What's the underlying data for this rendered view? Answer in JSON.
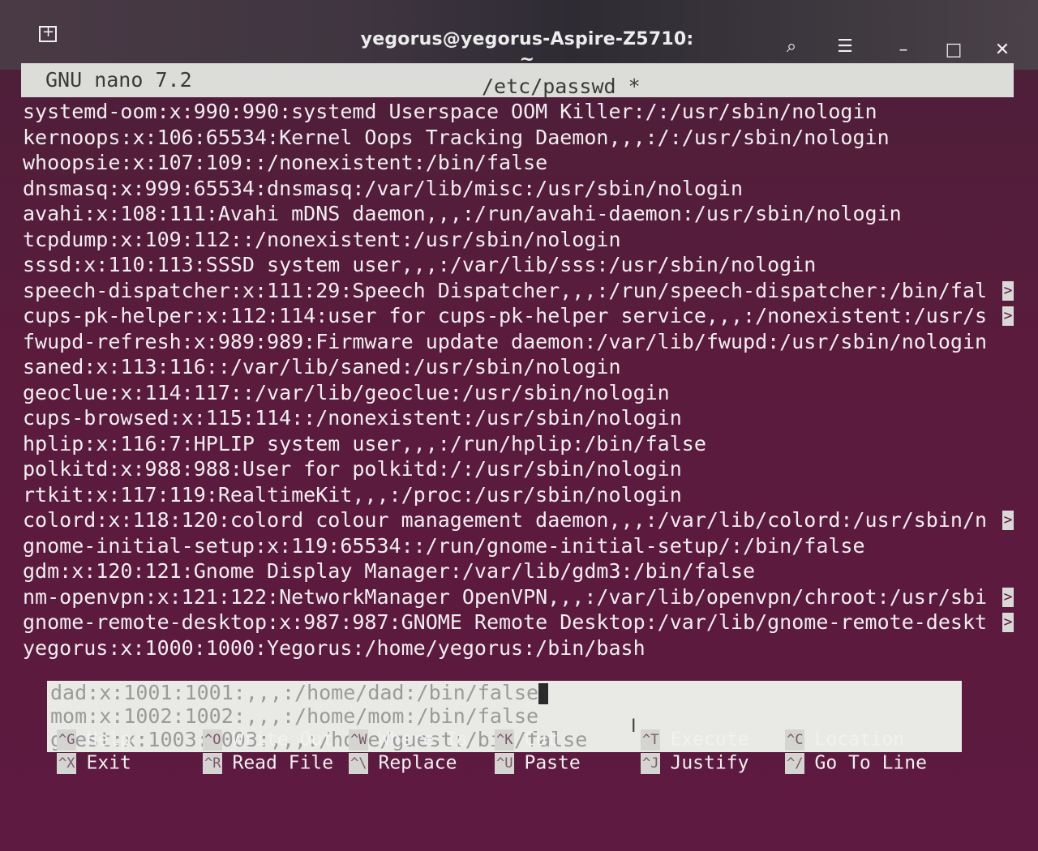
{
  "window": {
    "title": "yegorus@yegorus-Aspire-Z5710: ~",
    "icons": {
      "new_tab": "new-tab-icon",
      "search": "search-icon",
      "menu": "hamburger-menu-icon",
      "minimize": "minimize-icon",
      "maximize": "maximize-icon",
      "close": "close-icon"
    },
    "glyphs": {
      "search": "⌕",
      "menu": "☰",
      "minimize": "–",
      "maximize": "□",
      "close": "✕",
      "more": ">"
    }
  },
  "nano": {
    "version": "GNU nano 7.2",
    "filename": "/etc/passwd *",
    "lines": [
      {
        "text": "systemd-oom:x:990:990:systemd Userspace OOM Killer:/:/usr/sbin/nologin",
        "truncated": false
      },
      {
        "text": "kernoops:x:106:65534:Kernel Oops Tracking Daemon,,,:/:/usr/sbin/nologin",
        "truncated": false
      },
      {
        "text": "whoopsie:x:107:109::/nonexistent:/bin/false",
        "truncated": false
      },
      {
        "text": "dnsmasq:x:999:65534:dnsmasq:/var/lib/misc:/usr/sbin/nologin",
        "truncated": false
      },
      {
        "text": "avahi:x:108:111:Avahi mDNS daemon,,,:/run/avahi-daemon:/usr/sbin/nologin",
        "truncated": false
      },
      {
        "text": "tcpdump:x:109:112::/nonexistent:/usr/sbin/nologin",
        "truncated": false
      },
      {
        "text": "sssd:x:110:113:SSSD system user,,,:/var/lib/sss:/usr/sbin/nologin",
        "truncated": false
      },
      {
        "text": "speech-dispatcher:x:111:29:Speech Dispatcher,,,:/run/speech-dispatcher:/bin/fal",
        "truncated": true
      },
      {
        "text": "cups-pk-helper:x:112:114:user for cups-pk-helper service,,,:/nonexistent:/usr/s",
        "truncated": true
      },
      {
        "text": "fwupd-refresh:x:989:989:Firmware update daemon:/var/lib/fwupd:/usr/sbin/nologin",
        "truncated": false
      },
      {
        "text": "saned:x:113:116::/var/lib/saned:/usr/sbin/nologin",
        "truncated": false
      },
      {
        "text": "geoclue:x:114:117::/var/lib/geoclue:/usr/sbin/nologin",
        "truncated": false
      },
      {
        "text": "cups-browsed:x:115:114::/nonexistent:/usr/sbin/nologin",
        "truncated": false
      },
      {
        "text": "hplip:x:116:7:HPLIP system user,,,:/run/hplip:/bin/false",
        "truncated": false
      },
      {
        "text": "polkitd:x:988:988:User for polkitd:/:/usr/sbin/nologin",
        "truncated": false
      },
      {
        "text": "rtkit:x:117:119:RealtimeKit,,,:/proc:/usr/sbin/nologin",
        "truncated": false
      },
      {
        "text": "colord:x:118:120:colord colour management daemon,,,:/var/lib/colord:/usr/sbin/n",
        "truncated": true
      },
      {
        "text": "gnome-initial-setup:x:119:65534::/run/gnome-initial-setup/:/bin/false",
        "truncated": false
      },
      {
        "text": "gdm:x:120:121:Gnome Display Manager:/var/lib/gdm3:/bin/false",
        "truncated": false
      },
      {
        "text": "nm-openvpn:x:121:122:NetworkManager OpenVPN,,,:/var/lib/openvpn/chroot:/usr/sbi",
        "truncated": true
      },
      {
        "text": "gnome-remote-desktop:x:987:987:GNOME Remote Desktop:/var/lib/gnome-remote-deskt",
        "truncated": true
      },
      {
        "text": "yegorus:x:1000:1000:Yegorus:/home/yegorus:/bin/bash",
        "truncated": false
      }
    ],
    "selected_lines": [
      "dad:x:1001:1001:,,,:/home/dad:/bin/false",
      "mom:x:1002:1002:,,,:/home/mom:/bin/false",
      "guest:x:1003:1003:,,,:/home/guest:/bin/false"
    ],
    "shortcuts": [
      {
        "key": "^G",
        "label": "Help"
      },
      {
        "key": "^X",
        "label": "Exit"
      },
      {
        "key": "^O",
        "label": "Write Out"
      },
      {
        "key": "^R",
        "label": "Read File"
      },
      {
        "key": "^W",
        "label": "Where Is"
      },
      {
        "key": "^\\",
        "label": "Replace"
      },
      {
        "key": "^K",
        "label": "Cut"
      },
      {
        "key": "^U",
        "label": "Paste"
      },
      {
        "key": "^T",
        "label": "Execute"
      },
      {
        "key": "^J",
        "label": "Justify"
      },
      {
        "key": "^C",
        "label": "Location"
      },
      {
        "key": "^/",
        "label": "Go To Line"
      }
    ]
  }
}
